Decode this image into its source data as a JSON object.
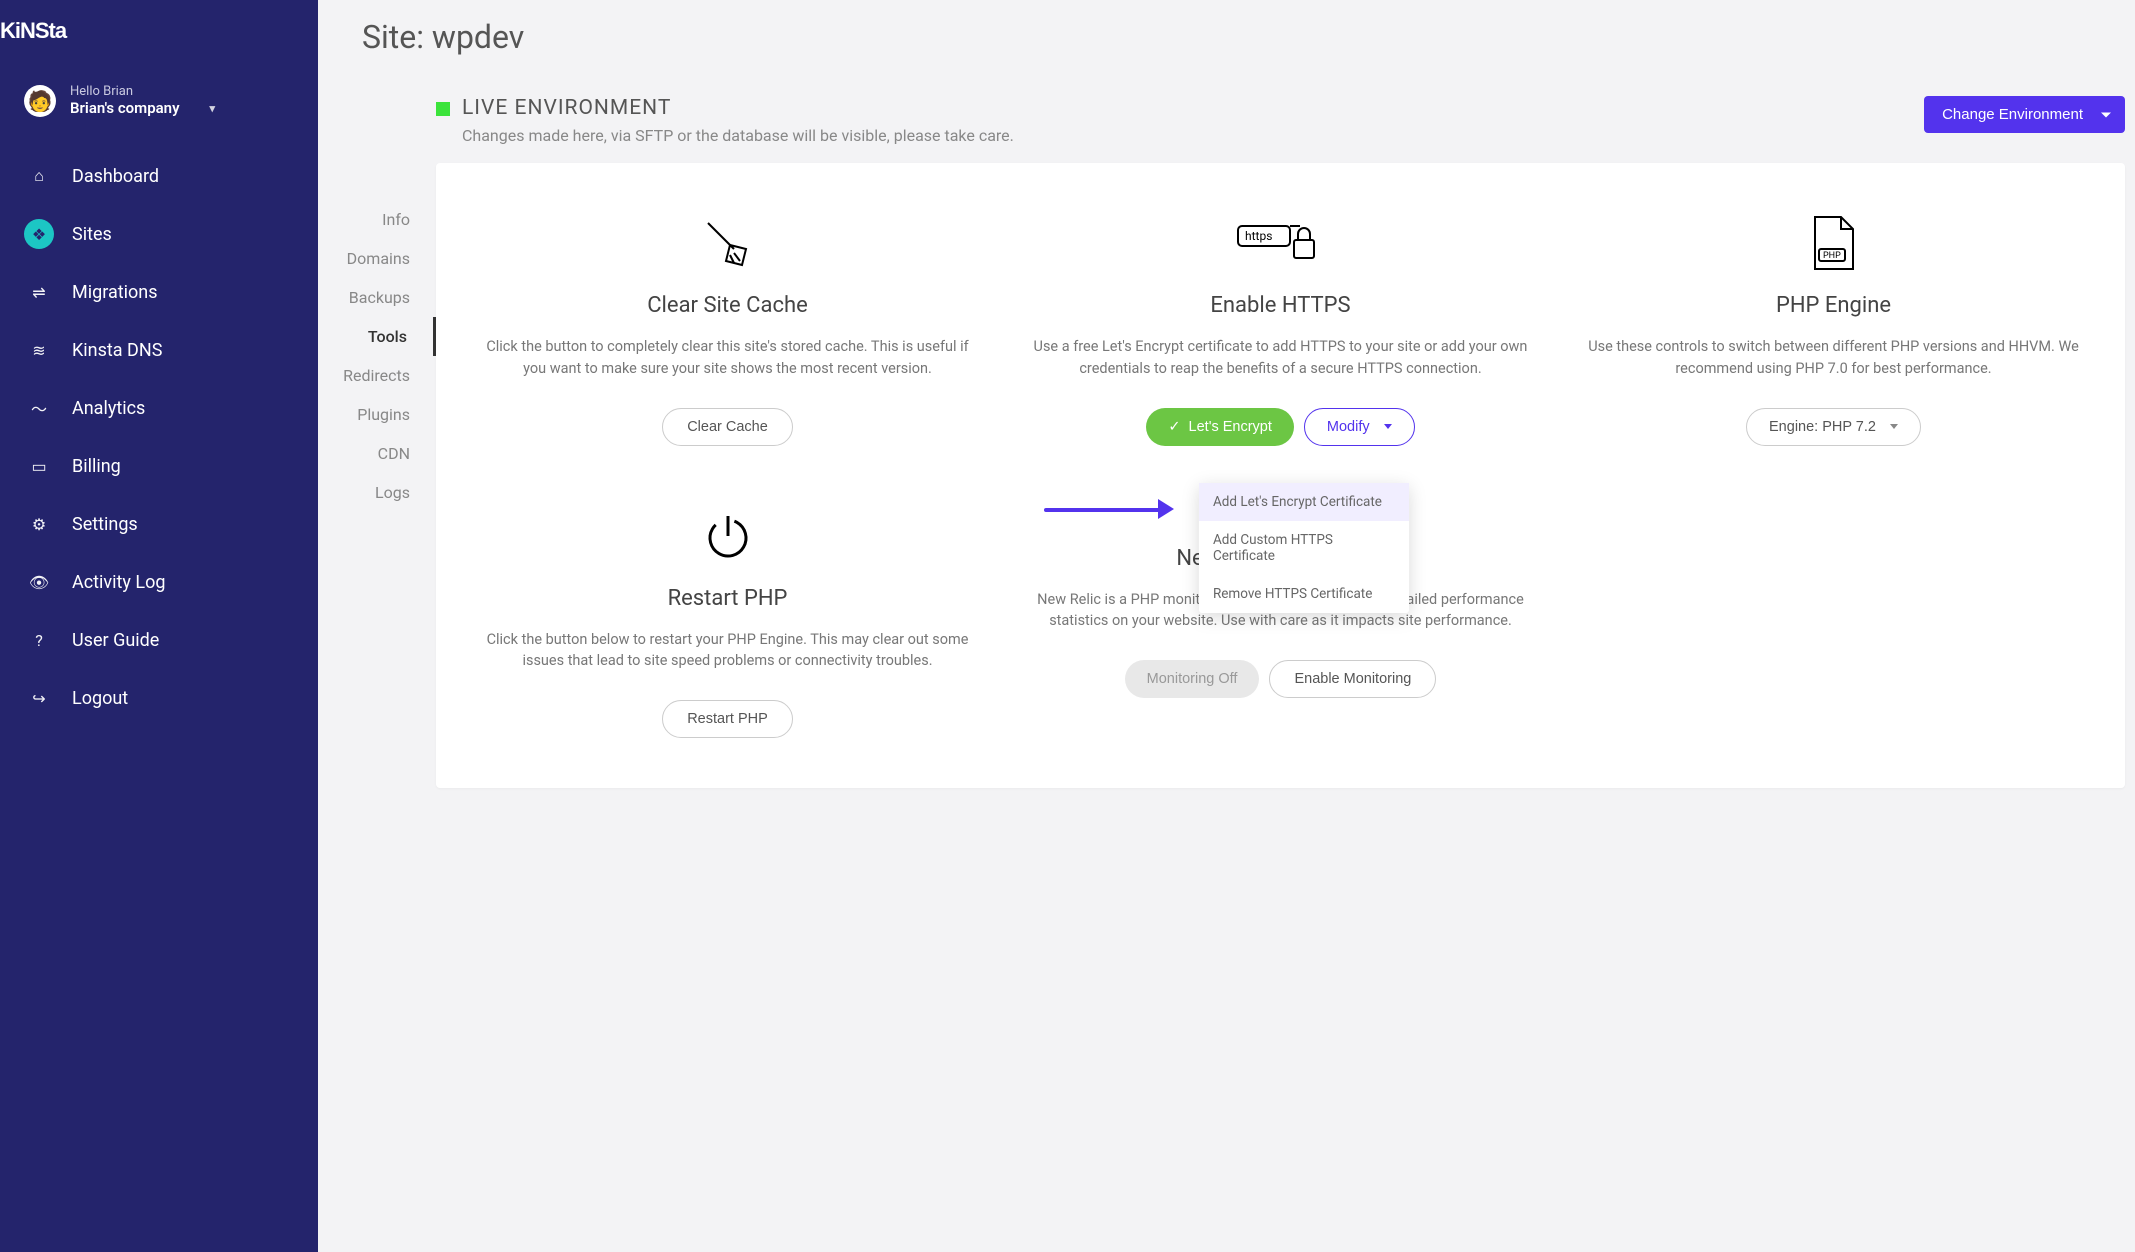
{
  "brand": "kinsta",
  "user": {
    "hello": "Hello Brian",
    "company": "Brian's company"
  },
  "nav": {
    "dashboard": "Dashboard",
    "sites": "Sites",
    "migrations": "Migrations",
    "dns": "Kinsta DNS",
    "analytics": "Analytics",
    "billing": "Billing",
    "settings": "Settings",
    "activity": "Activity Log",
    "guide": "User Guide",
    "logout": "Logout"
  },
  "page_title": "Site: wpdev",
  "env": {
    "title": "LIVE ENVIRONMENT",
    "sub": "Changes made here, via SFTP or the database will be visible, please take care.",
    "change_btn": "Change Environment"
  },
  "subnav": {
    "info": "Info",
    "domains": "Domains",
    "backups": "Backups",
    "tools": "Tools",
    "redirects": "Redirects",
    "plugins": "Plugins",
    "cdn": "CDN",
    "logs": "Logs"
  },
  "cards": {
    "cache": {
      "title": "Clear Site Cache",
      "desc": "Click the button to completely clear this site's stored cache. This is useful if you want to make sure your site shows the most recent version.",
      "btn": "Clear Cache"
    },
    "https": {
      "title": "Enable HTTPS",
      "desc": "Use a free Let's Encrypt certificate to add HTTPS to your site or add your own credentials to reap the benefits of a secure HTTPS connection.",
      "btn_encrypt": "Let's Encrypt",
      "btn_modify": "Modify",
      "https_badge": "https"
    },
    "php": {
      "title": "PHP Engine",
      "desc": "Use these controls to switch between different PHP versions and HHVM. We recommend using PHP 7.0 for best performance.",
      "btn": "Engine: PHP 7.2",
      "file_label": "PHP"
    },
    "restart": {
      "title": "Restart PHP",
      "desc": "Click the button below to restart your PHP Engine. This may clear out some issues that lead to site speed problems or connectivity troubles.",
      "btn": "Restart PHP"
    },
    "newrelic": {
      "title": "New Relic Monitoring",
      "desc": "New Relic is a PHP monitoring tool you can use to get detailed performance statistics on your website. Use with care as it impacts site performance.",
      "btn_off": "Monitoring Off",
      "btn_enable": "Enable Monitoring"
    }
  },
  "dropdown": {
    "add_le": "Add Let's Encrypt Certificate",
    "add_custom": "Add Custom HTTPS Certificate",
    "remove": "Remove HTTPS Certificate"
  }
}
